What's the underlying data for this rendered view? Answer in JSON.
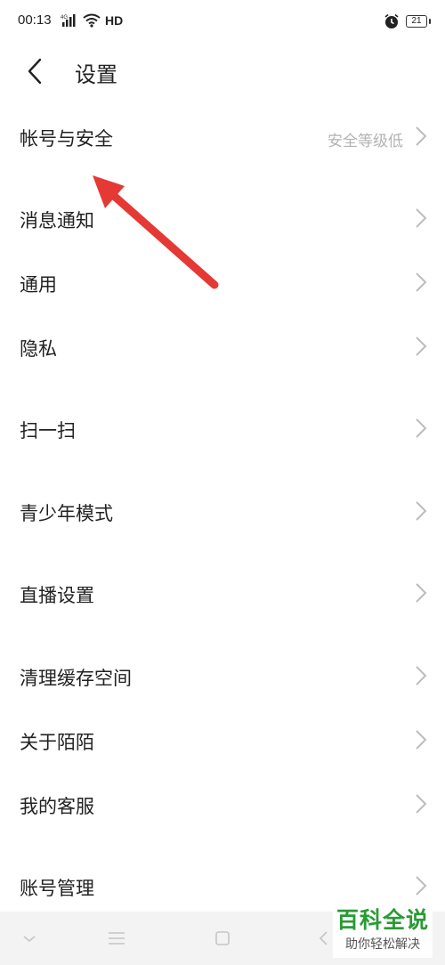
{
  "status_bar": {
    "time": "00:13",
    "network_badge": "4G",
    "hd": "HD",
    "battery": "21",
    "icons": [
      "signal-icon",
      "wifi-icon",
      "alarm-icon",
      "battery-icon"
    ]
  },
  "header": {
    "title": "设置",
    "back_icon": "back-arrow-icon"
  },
  "menu": {
    "items": [
      {
        "label": "帐号与安全",
        "detail": "安全等级低"
      },
      {
        "label": "消息通知"
      },
      {
        "label": "通用"
      },
      {
        "label": "隐私"
      },
      {
        "label": "扫一扫"
      },
      {
        "label": "青少年模式"
      },
      {
        "label": "直播设置"
      },
      {
        "label": "清理缓存空间"
      },
      {
        "label": "关于陌陌"
      },
      {
        "label": "我的客服"
      },
      {
        "label": "账号管理"
      }
    ]
  },
  "annotation": {
    "arrow_color": "#e53935"
  },
  "system_nav": {
    "icons": [
      "collapse-icon",
      "menu-icon",
      "home-icon",
      "back-icon"
    ]
  },
  "watermark": {
    "title": "百科全说",
    "subtitle": "助你轻松解决",
    "color": "#2a9a35"
  }
}
